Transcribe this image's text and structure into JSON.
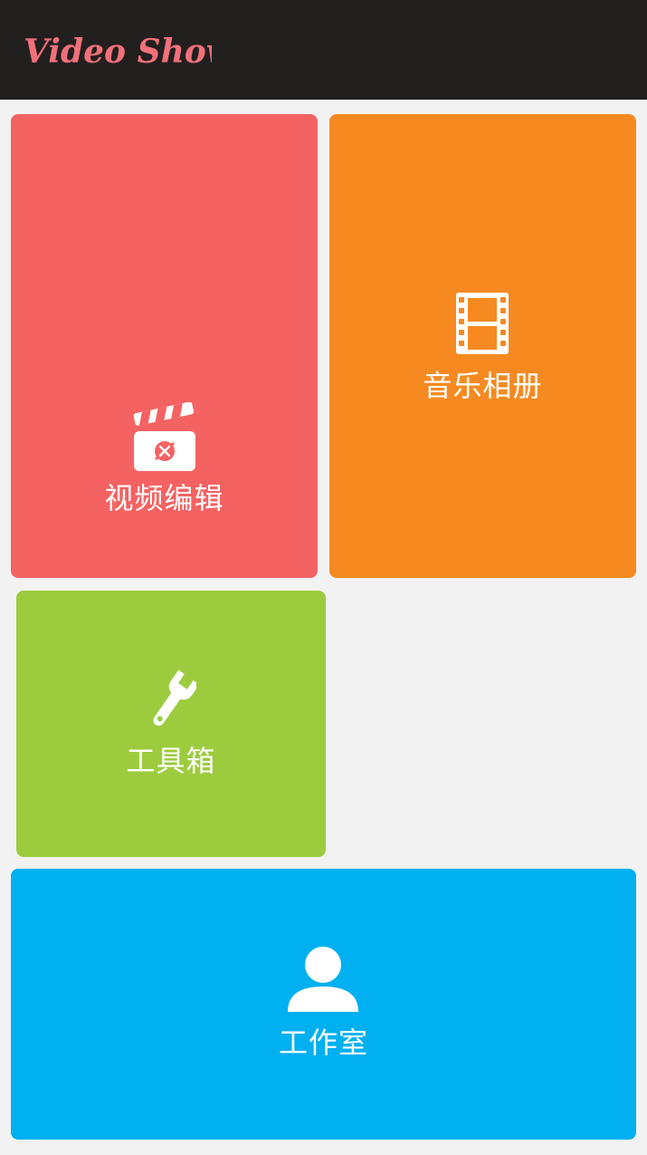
{
  "header": {
    "app_name": "Video Show",
    "background": "#221f1f",
    "logo_color": "#f2707a"
  },
  "tiles": [
    {
      "key": "video_edit",
      "label": "视频编辑",
      "color": "#f56262",
      "icon": "clapperboard-icon"
    },
    {
      "key": "music_album",
      "label": "音乐相册",
      "color": "#f68a21",
      "icon": "film-strip-icon"
    },
    {
      "key": "toolbox",
      "label": "工具箱",
      "color": "#9ccc3e",
      "icon": "wrench-icon"
    },
    {
      "key": "studio",
      "label": "工作室",
      "color": "#00b0f0",
      "icon": "user-icon"
    }
  ]
}
